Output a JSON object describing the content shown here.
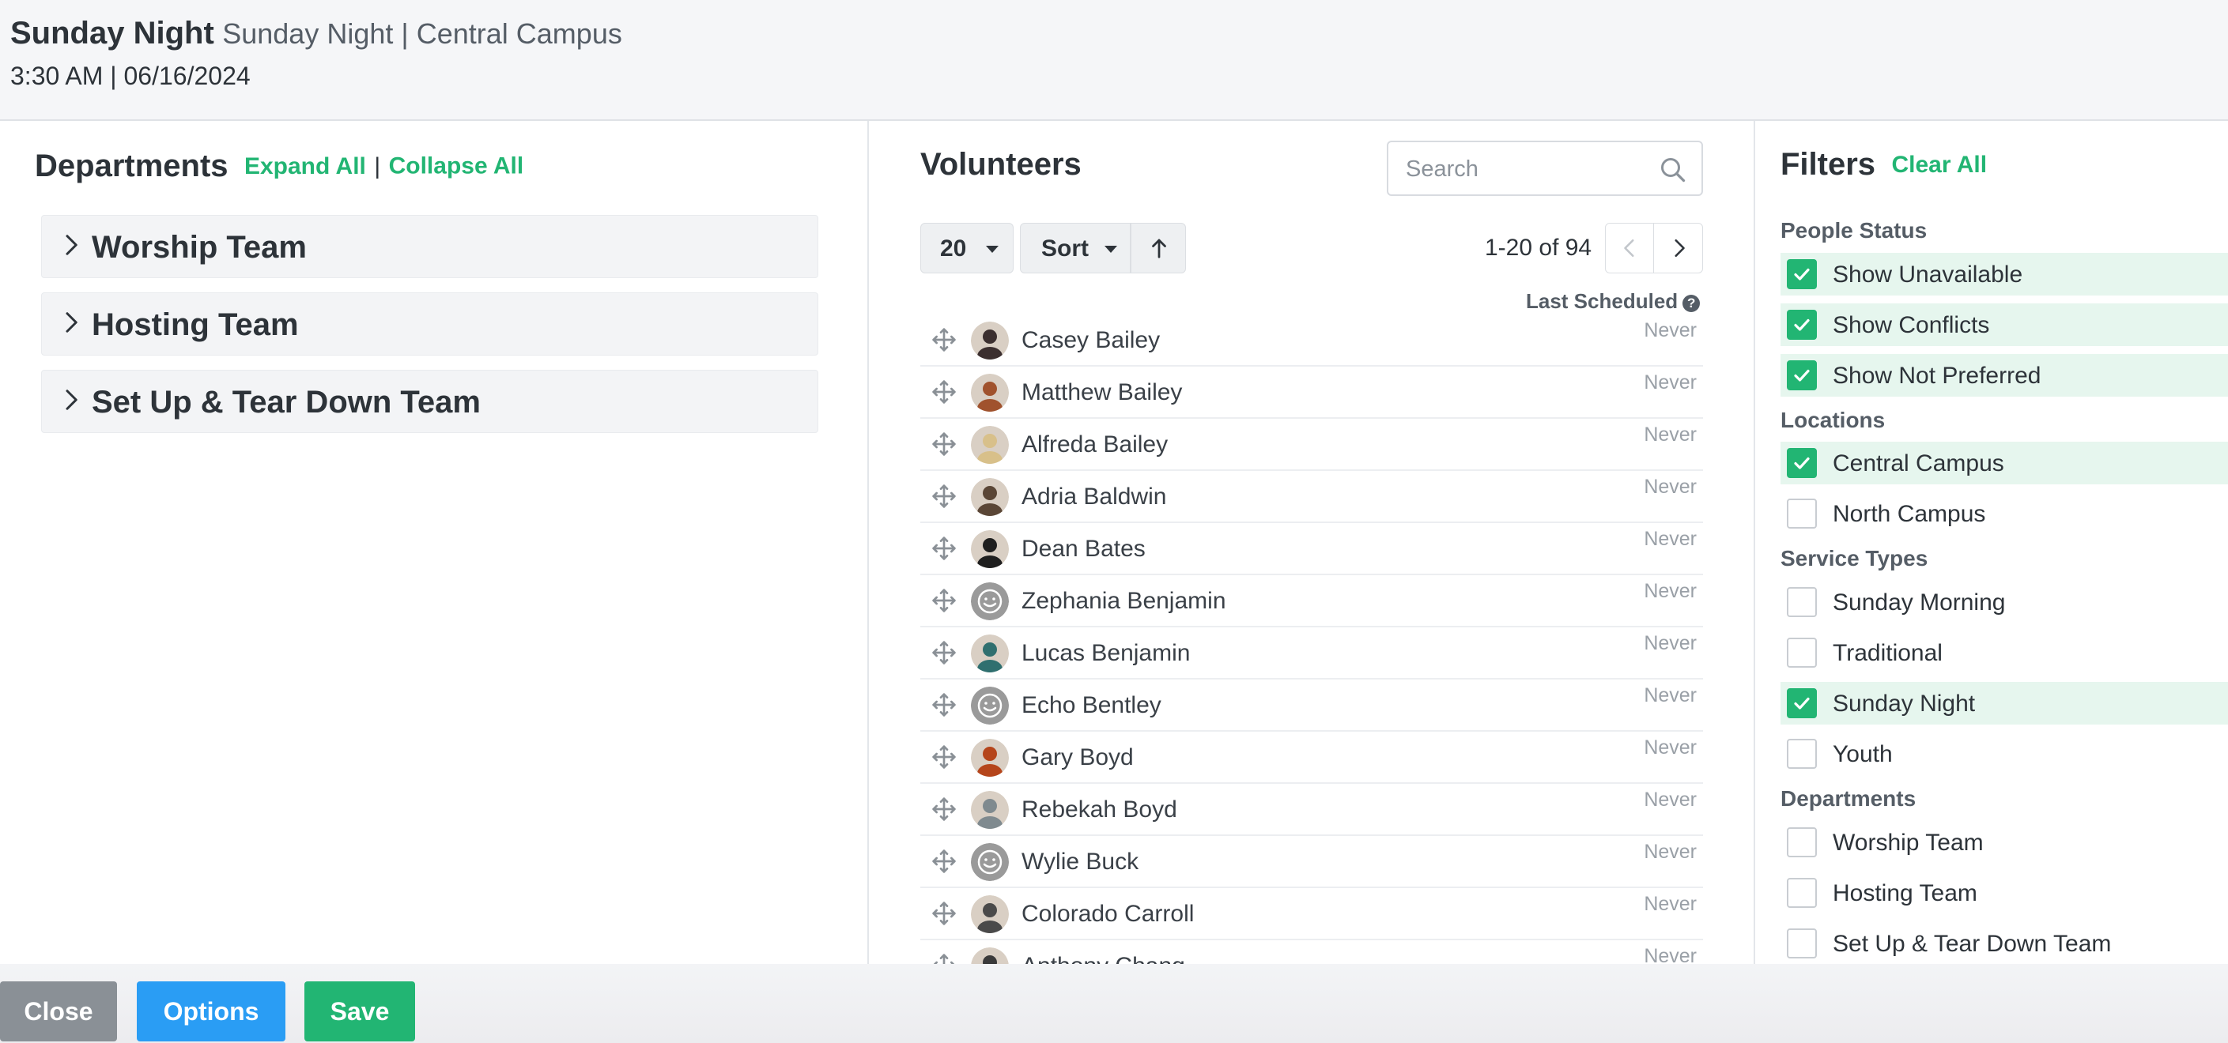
{
  "header": {
    "title": "Sunday Night",
    "subtitle": "Sunday Night | Central Campus",
    "datetime": "3:30 AM | 06/16/2024"
  },
  "departments": {
    "title": "Departments",
    "expand_all": "Expand All",
    "separator": "|",
    "collapse_all": "Collapse All",
    "items": [
      {
        "label": "Worship Team"
      },
      {
        "label": "Hosting Team"
      },
      {
        "label": "Set Up & Tear Down Team"
      }
    ]
  },
  "volunteers": {
    "title": "Volunteers",
    "search_placeholder": "Search",
    "page_size": "20",
    "sort_label": "Sort",
    "pagination": "1-20 of 94",
    "last_scheduled_label": "Last Scheduled",
    "rows": [
      {
        "name": "Casey Bailey",
        "last": "Never",
        "avatar": "photo"
      },
      {
        "name": "Matthew Bailey",
        "last": "Never",
        "avatar": "photo"
      },
      {
        "name": "Alfreda Bailey",
        "last": "Never",
        "avatar": "photo"
      },
      {
        "name": "Adria Baldwin",
        "last": "Never",
        "avatar": "photo"
      },
      {
        "name": "Dean Bates",
        "last": "Never",
        "avatar": "photo"
      },
      {
        "name": "Zephania Benjamin",
        "last": "Never",
        "avatar": "default-smiley"
      },
      {
        "name": "Lucas Benjamin",
        "last": "Never",
        "avatar": "photo"
      },
      {
        "name": "Echo Bentley",
        "last": "Never",
        "avatar": "default-smiley"
      },
      {
        "name": "Gary Boyd",
        "last": "Never",
        "avatar": "photo"
      },
      {
        "name": "Rebekah Boyd",
        "last": "Never",
        "avatar": "photo"
      },
      {
        "name": "Wylie Buck",
        "last": "Never",
        "avatar": "default-smiley"
      },
      {
        "name": "Colorado Carroll",
        "last": "Never",
        "avatar": "photo"
      },
      {
        "name": "Anthony Chang",
        "last": "Never",
        "avatar": "photo"
      }
    ]
  },
  "filters": {
    "title": "Filters",
    "clear_all": "Clear All",
    "groups": {
      "people_status": "People Status",
      "locations": "Locations",
      "service_types": "Service Types",
      "departments": "Departments"
    },
    "people_status": [
      {
        "label": "Show Unavailable",
        "checked": true
      },
      {
        "label": "Show Conflicts",
        "checked": true
      },
      {
        "label": "Show Not Preferred",
        "checked": true
      }
    ],
    "locations": [
      {
        "label": "Central Campus",
        "checked": true
      },
      {
        "label": "North Campus",
        "checked": false
      }
    ],
    "service_types": [
      {
        "label": "Sunday Morning",
        "checked": false
      },
      {
        "label": "Traditional",
        "checked": false
      },
      {
        "label": "Sunday Night",
        "checked": true
      },
      {
        "label": "Youth",
        "checked": false
      }
    ],
    "departments": [
      {
        "label": "Worship Team",
        "checked": false
      },
      {
        "label": "Hosting Team",
        "checked": false
      },
      {
        "label": "Set Up & Tear Down Team",
        "checked": false
      }
    ]
  },
  "footer": {
    "close": "Close",
    "options": "Options",
    "save": "Save"
  },
  "colors": {
    "accent_green": "#22b573",
    "options_blue": "#2a9df4",
    "close_gray": "#8a9096",
    "filter_checked_bg": "#e6f6ee"
  },
  "icons": {
    "chevron": "chevron-right-icon",
    "search": "search-icon",
    "drag": "drag-move-icon",
    "help": "help-circle-icon",
    "sort_direction": "arrow-up-icon",
    "pager_prev": "chevron-left-icon",
    "pager_next": "chevron-right-icon",
    "checkbox": "checkmark-icon"
  }
}
